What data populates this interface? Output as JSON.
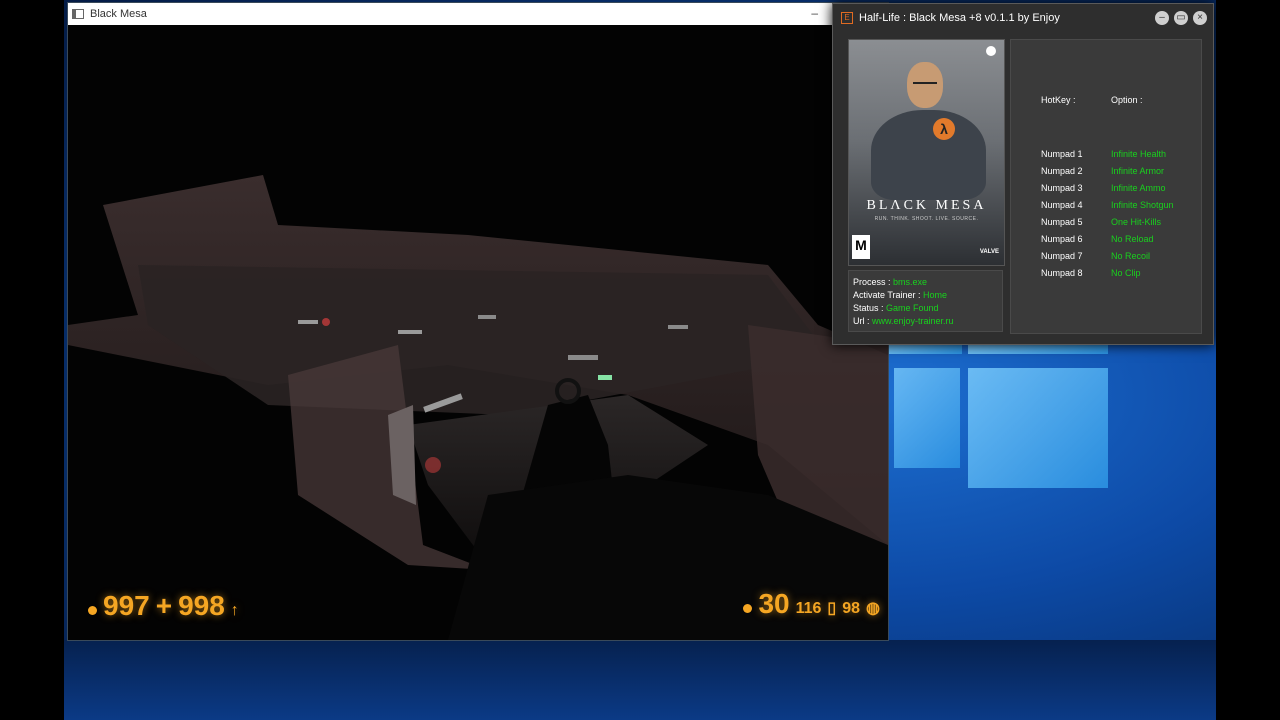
{
  "game_window": {
    "title": "Black Mesa",
    "minimize_glyph": "–",
    "hud": {
      "health": "997",
      "separator": "+",
      "armor": "998",
      "ammo_clip": "30",
      "ammo_reserve": "116",
      "grenades": "98"
    }
  },
  "trainer": {
    "title": "Half-Life : Black Mesa +8 v0.1.1 by Enjoy",
    "icon_glyph": "E",
    "controls": {
      "minimize": "–",
      "maximize": "▭",
      "close": "×"
    },
    "cover": {
      "title": "BLΛCK MESA",
      "tagline": "RUN. THINK. SHOOT. LIVE. SOURCE.",
      "rating": "M",
      "publisher": "VALVE",
      "lambda": "λ"
    },
    "info": {
      "process_label": "Process :",
      "process_value": "bms.exe",
      "activate_label": "Activate Trainer :",
      "activate_value": "Home",
      "status_label": "Status :",
      "status_value": "Game Found",
      "url_label": "Url :",
      "url_value": "www.enjoy-trainer.ru"
    },
    "options_header": {
      "hotkey": "HotKey :",
      "option": "Option :"
    },
    "options": [
      {
        "hotkey": "Numpad 1",
        "option": "Infinite Health"
      },
      {
        "hotkey": "Numpad 2",
        "option": "Infinite Armor"
      },
      {
        "hotkey": "Numpad 3",
        "option": "Infinite Ammo"
      },
      {
        "hotkey": "Numpad 4",
        "option": "Infinite Shotgun"
      },
      {
        "hotkey": "Numpad 5",
        "option": "One Hit-Kills"
      },
      {
        "hotkey": "Numpad 6",
        "option": "No Reload"
      },
      {
        "hotkey": "Numpad 7",
        "option": "No Recoil"
      },
      {
        "hotkey": "Numpad 8",
        "option": "No Clip"
      }
    ]
  },
  "colors": {
    "hud_orange": "#f5a623",
    "option_green": "#19d11e",
    "trainer_bg": "#2e2e2e"
  }
}
